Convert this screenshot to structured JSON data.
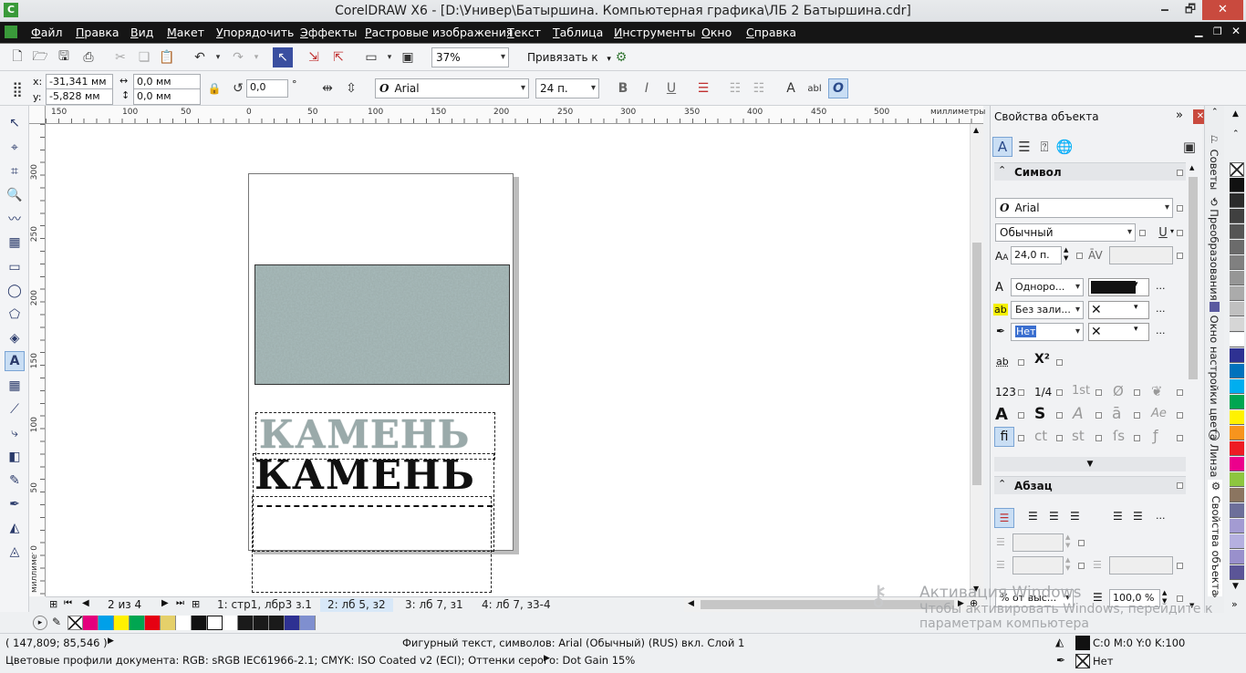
{
  "title_bar": {
    "title": "CorelDRAW X6 - [D:\\Универ\\Батыршина. Компьютерная графика\\ЛБ 2 Батыршина.cdr]",
    "minimize": "🗕",
    "maximize": "🗗",
    "close": "✕"
  },
  "menu": [
    "Файл",
    "Правка",
    "Вид",
    "Макет",
    "Упорядочить",
    "Эффекты",
    "Растровые изображения",
    "Текст",
    "Таблица",
    "Инструменты",
    "Окно",
    "Справка"
  ],
  "standard_bar": {
    "zoom": "37%",
    "snap_label": "Привязать к"
  },
  "property_bar": {
    "x_label": "x:",
    "x_value": "-31,341 мм",
    "y_label": "y:",
    "y_value": "-5,828 мм",
    "w_value": "0,0 мм",
    "h_value": "0,0 мм",
    "rotation_value": "0,0",
    "degree": "°",
    "font_name": "Arial",
    "font_size": "24 п."
  },
  "ruler": {
    "h_ticks": [
      "150",
      "100",
      "50",
      "0",
      "50",
      "100",
      "150",
      "200",
      "250",
      "300",
      "350",
      "400",
      "450",
      "500"
    ],
    "h_unit": "миллиметры",
    "v_ticks": [
      "300",
      "250",
      "200",
      "150",
      "100",
      "50",
      "0"
    ],
    "v_unit": "миллиметры"
  },
  "canvas": {
    "text_texture": "КАМЕНЬ",
    "text_black": "КАМЕНЬ"
  },
  "page_nav": {
    "counter": "2 из 4",
    "tabs": [
      "1: стр1, лбр3 з.1",
      "2: лб 5, з2",
      "3: лб 7, з1",
      "4: лб 7, з3-4"
    ],
    "active_tab": 1
  },
  "palette_bar": {
    "colors": [
      "#ffffff",
      "#e4007d",
      "#00a0e9",
      "#fff100",
      "#00a651",
      "#e60012",
      "#e5d06a",
      "#ffffff",
      "#111111",
      "#ffffff",
      "#ffffff",
      "#1a1a1a",
      "#1a1a1a",
      "#1a1a1a",
      "#1a1a1a",
      "#2e3192",
      "#7f8fcf"
    ]
  },
  "status": {
    "coords": "( 147,809; 85,546 )",
    "info": "Фигурный текст, символов: Arial (Обычный) (RUS) вкл. Слой 1",
    "profiles": "Цветовые профили документа: RGB: sRGB IEC61966-2.1; CMYK: ISO Coated v2 (ECI); Оттенки серого: Dot Gain 15%",
    "fill": "C:0 M:0 Y:0 K:100",
    "outline": "Нет"
  },
  "docker": {
    "title": "Свойства объекта",
    "char_section": "Символ",
    "font": "Arial",
    "style": "Обычный",
    "size": "24,0 п.",
    "fill_type": "Одноро...",
    "bg_type": "Без зали...",
    "outline_type": "Нет",
    "para_section": "Абзац",
    "para_spacing": "% от выс...",
    "para_percent": "100,0 %",
    "sup_label": "X²",
    "num_labels": [
      "123",
      "1/4",
      "1st"
    ]
  },
  "dock_tabs": [
    "Советы",
    "Преобразования",
    "Окно настройки цвета",
    "Линза",
    "Свойства объекта"
  ],
  "right_palette": [
    "#ffffff",
    "#111111",
    "#2b2b2b",
    "#404040",
    "#555555",
    "#6b6b6b",
    "#808080",
    "#969696",
    "#ababab",
    "#c0c0c0",
    "#d6d6d6",
    "#ebebeb",
    "#ffffff",
    "#2e3192",
    "#0072bc",
    "#00aeef",
    "#00a651",
    "#fff200",
    "#f7941d",
    "#ed1c24",
    "#ec008c",
    "#8dc63f",
    "#f26522",
    "#8b7560",
    "#6d6f9a",
    "#a39bd2",
    "#b5b0e0",
    "#c7c3ea",
    "#9990cc",
    "#7b74b8",
    "#5b5597"
  ],
  "watermark": {
    "line1": "Активация Windows",
    "line2": "Чтобы активировать Windows, перейдите к",
    "line3": "параметрам компьютера"
  }
}
